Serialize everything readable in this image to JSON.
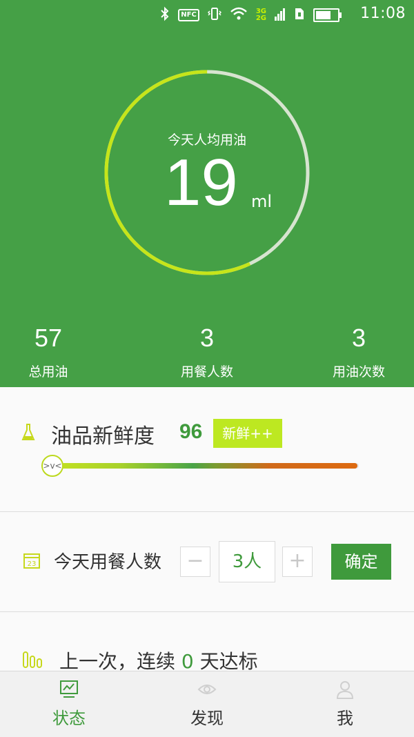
{
  "status_bar": {
    "nfc_label": "NFC",
    "network": [
      "3G",
      "2G"
    ],
    "battery_level": 0.7,
    "time": "11:08"
  },
  "hero": {
    "ring_label": "今天人均用油",
    "ring_value": "19",
    "ring_unit": "ml",
    "ring_progress": 0.57,
    "stats": [
      {
        "value": "57",
        "label": "总用油"
      },
      {
        "value": "3",
        "label": "用餐人数"
      },
      {
        "value": "3",
        "label": "用油次数"
      }
    ]
  },
  "freshness": {
    "icon": "flask-icon",
    "title": "油品新鲜度",
    "score": "96",
    "badge": "新鲜++",
    "thumb_face": ">v<",
    "level": 0.96
  },
  "diners": {
    "icon": "calendar-icon",
    "calendar_day": "23",
    "title": "今天用餐人数",
    "minus": "−",
    "value": "3人",
    "plus": "+",
    "confirm": "确定"
  },
  "streak": {
    "icon": "bars-icon",
    "prefix": "上一次，连续 ",
    "count": "0",
    "suffix": " 天达标"
  },
  "bottom_nav": [
    {
      "label": "状态",
      "icon": "chart-icon",
      "active": true
    },
    {
      "label": "发现",
      "icon": "eye-icon",
      "active": false
    },
    {
      "label": "我",
      "icon": "person-icon",
      "active": false
    }
  ],
  "colors": {
    "primary_green": "#45a046",
    "accent_lime": "#bde821",
    "text_green": "#3f9a3c"
  }
}
